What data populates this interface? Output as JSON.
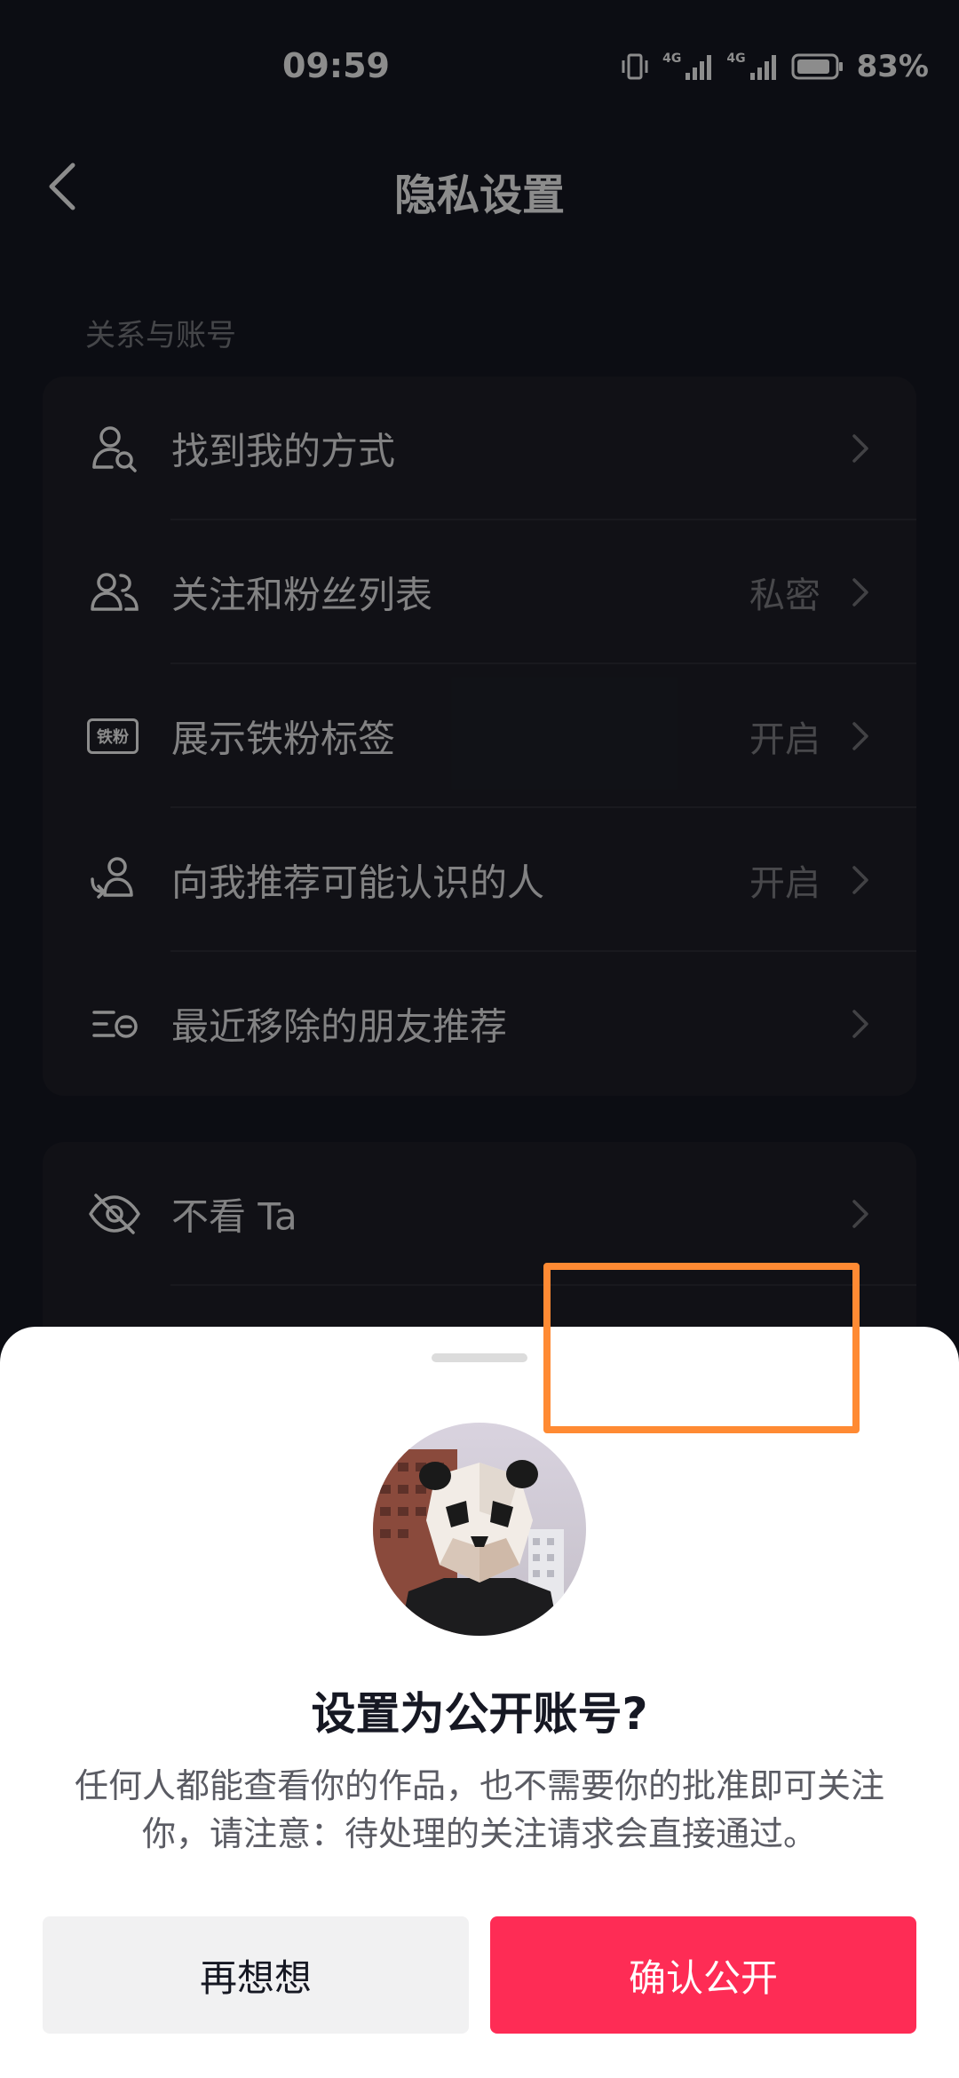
{
  "status_bar": {
    "time": "09:59",
    "battery_percent": "83%",
    "signal_1_label": "4G",
    "signal_2_label": "4G"
  },
  "nav": {
    "title": "隐私设置"
  },
  "section": {
    "label": "关系与账号"
  },
  "list_1": [
    {
      "label": "找到我的方式",
      "value": "",
      "icon": "person-search-icon"
    },
    {
      "label": "关注和粉丝列表",
      "value": "私密",
      "icon": "people-icon"
    },
    {
      "label": "展示铁粉标签",
      "value": "开启",
      "icon": "iron-fan-badge-icon",
      "badge_text": "铁粉"
    },
    {
      "label": "向我推荐可能认识的人",
      "value": "开启",
      "icon": "person-recommend-icon"
    },
    {
      "label": "最近移除的朋友推荐",
      "value": "",
      "icon": "list-eye-icon"
    }
  ],
  "list_2": [
    {
      "label": "不看 Ta",
      "value": "",
      "icon": "eye-off-icon"
    }
  ],
  "sheet": {
    "title": "设置为公开账号?",
    "description": "任何人都能查看你的作品，也不需要你的批准即可关注你，请注意：待处理的关注请求会直接通过。",
    "cancel_label": "再想想",
    "confirm_label": "确认公开"
  },
  "colors": {
    "background": "#161823",
    "accent": "#fe2c55",
    "highlight": "#ff8a33"
  }
}
